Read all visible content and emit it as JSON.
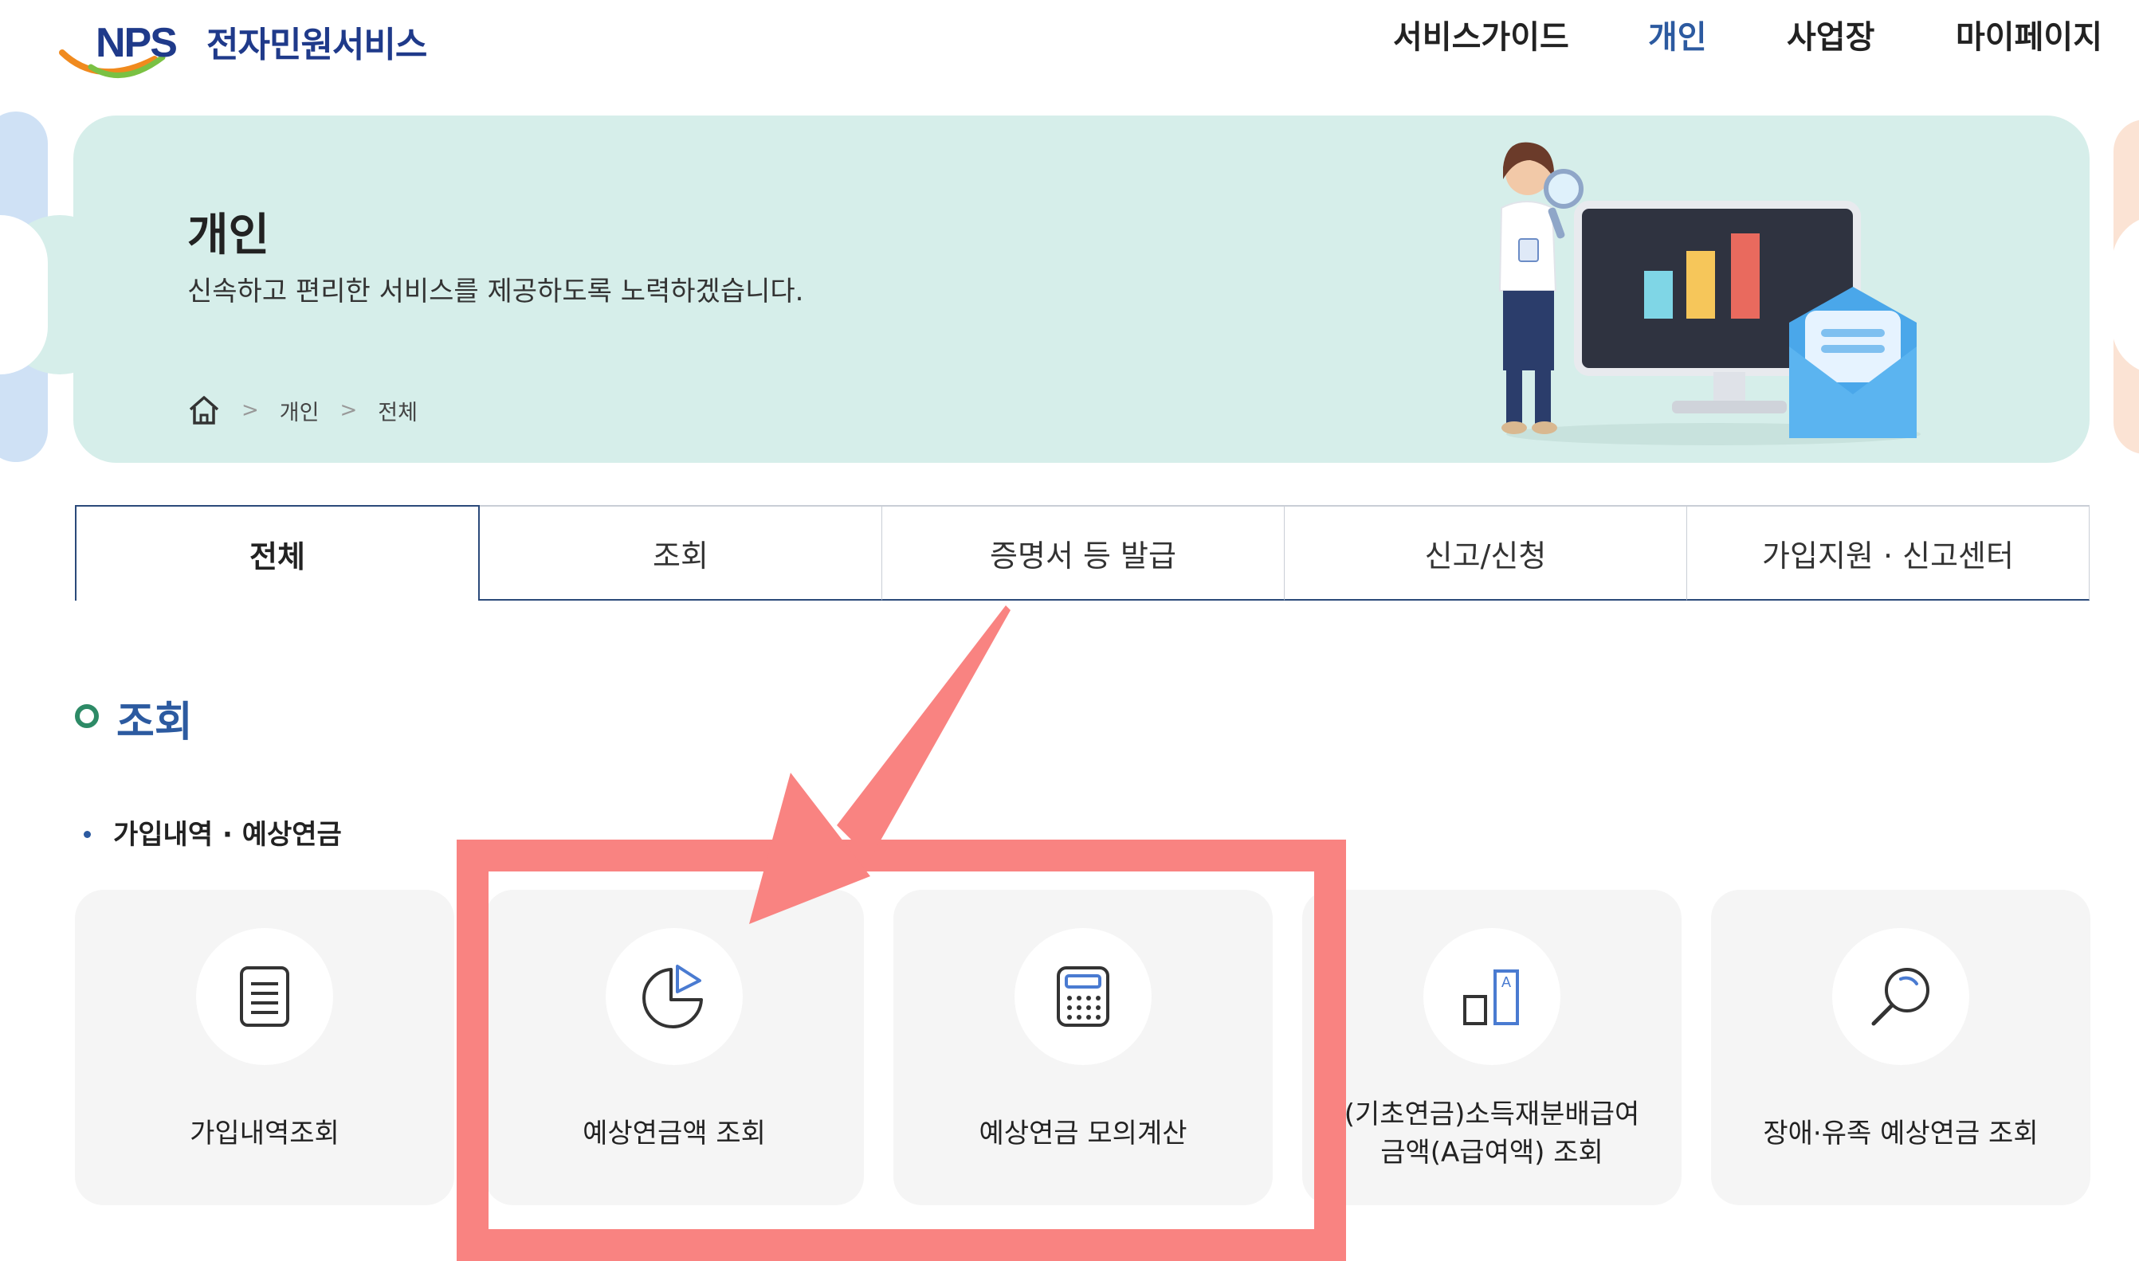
{
  "header": {
    "logo_mark": "NPS",
    "logo_text": "전자민원서비스",
    "nav": [
      {
        "label": "서비스가이드",
        "active": false
      },
      {
        "label": "개인",
        "active": true
      },
      {
        "label": "사업장",
        "active": false
      },
      {
        "label": "마이페이지",
        "active": false
      }
    ]
  },
  "hero": {
    "title": "개인",
    "subtitle": "신속하고 편리한 서비스를 제공하도록 노력하겠습니다.",
    "breadcrumb": [
      "개인",
      "전체"
    ]
  },
  "tabs": [
    {
      "label": "전체",
      "active": true
    },
    {
      "label": "조회",
      "active": false
    },
    {
      "label": "증명서 등 발급",
      "active": false
    },
    {
      "label": "신고/신청",
      "active": false
    },
    {
      "label": "가입지원 · 신고센터",
      "active": false
    }
  ],
  "section": {
    "title": "조회",
    "subtitle": "가입내역 · 예상연금",
    "cards": [
      {
        "label": "가입내역조회",
        "icon": "document-icon"
      },
      {
        "label": "예상연금액 조회",
        "icon": "pie-chart-icon"
      },
      {
        "label": "예상연금 모의계산",
        "icon": "calculator-icon"
      },
      {
        "label_line1": "(기초연금)소득재분배급여",
        "label_line2": "금액(A급여액) 조회",
        "icon": "compare-bars-icon"
      },
      {
        "label": "장애·유족 예상연금 조회",
        "icon": "magnifier-icon"
      }
    ]
  },
  "colors": {
    "brand_navy": "#1f3a8a",
    "active_blue": "#2c5aa0",
    "hero_bg": "#d6eeea",
    "annotation": "#f98381"
  }
}
